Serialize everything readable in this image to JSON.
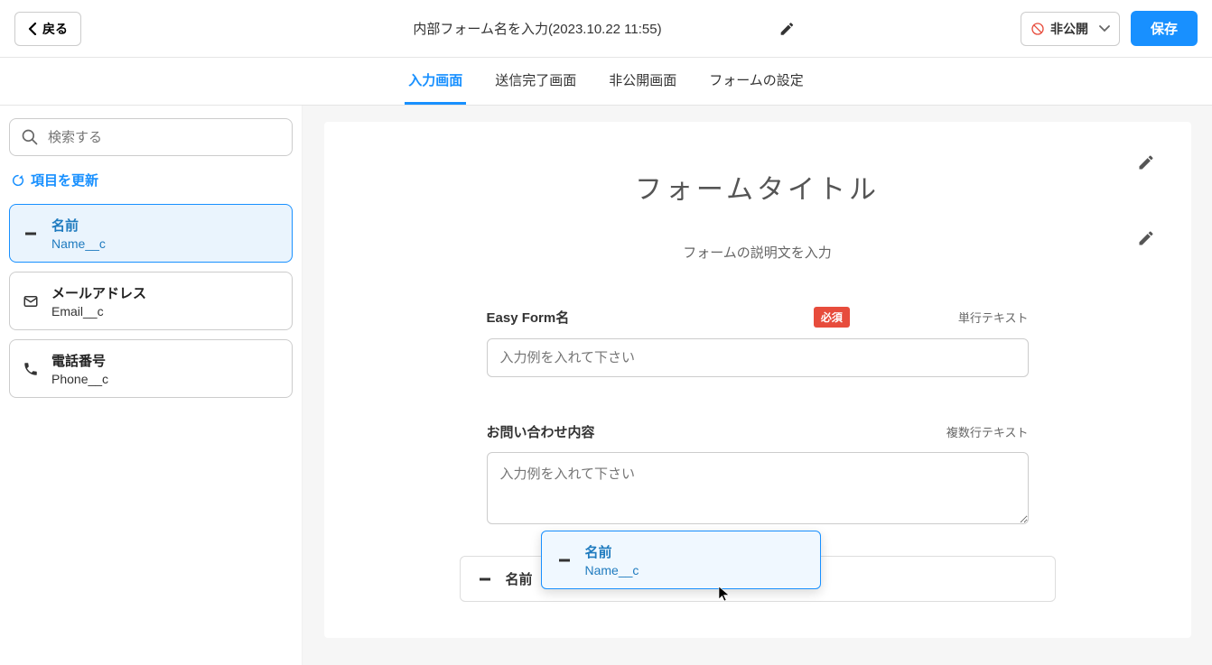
{
  "header": {
    "back_label": "戻る",
    "form_name": "内部フォーム名を入力(2023.10.22 11:55)",
    "visibility_label": "非公開",
    "save_label": "保存"
  },
  "tabs": [
    {
      "label": "入力画面",
      "active": true
    },
    {
      "label": "送信完了画面",
      "active": false
    },
    {
      "label": "非公開画面",
      "active": false
    },
    {
      "label": "フォームの設定",
      "active": false
    }
  ],
  "sidebar": {
    "search_placeholder": "検索する",
    "refresh_label": "項目を更新",
    "fields": [
      {
        "label": "名前",
        "api": "Name__c",
        "icon": "minus",
        "selected": true
      },
      {
        "label": "メールアドレス",
        "api": "Email__c",
        "icon": "mail",
        "selected": false
      },
      {
        "label": "電話番号",
        "api": "Phone__c",
        "icon": "phone",
        "selected": false
      }
    ]
  },
  "form": {
    "title": "フォームタイトル",
    "description": "フォームの説明文を入力",
    "required_badge": "必須",
    "fields": [
      {
        "label": "Easy Form名",
        "type_label": "単行テキスト",
        "required": true,
        "placeholder": "入力例を入れて下さい",
        "kind": "text"
      },
      {
        "label": "お問い合わせ内容",
        "type_label": "複数行テキスト",
        "required": false,
        "placeholder": "入力例を入れて下さい",
        "kind": "textarea"
      }
    ],
    "drag_ghost": {
      "label": "名前",
      "api": "Name__c"
    },
    "dropping": {
      "label": "名前"
    }
  }
}
